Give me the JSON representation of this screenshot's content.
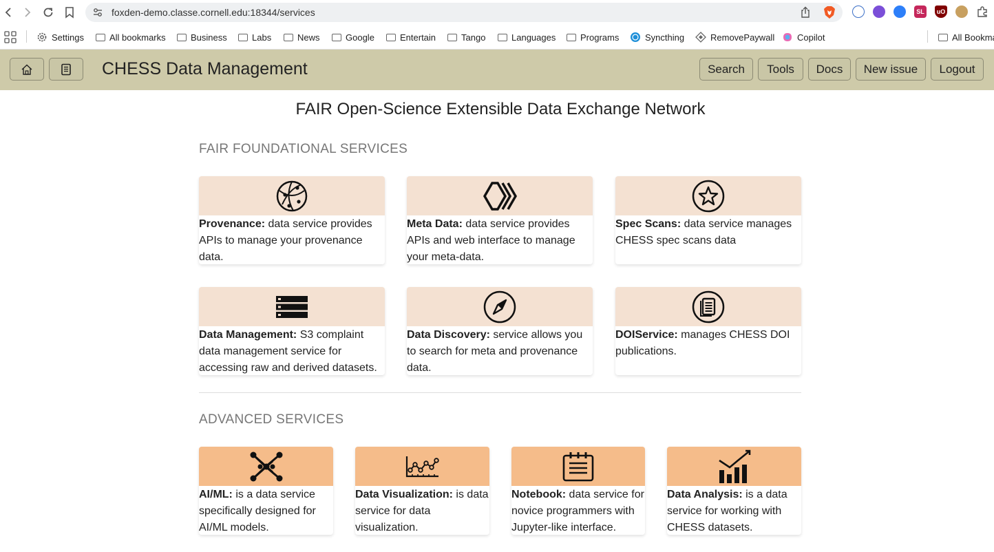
{
  "browser": {
    "url": "foxden-demo.classe.cornell.edu:18344/services",
    "bookmarks": [
      "Settings",
      "All bookmarks",
      "Business",
      "Labs",
      "News",
      "Google",
      "Entertain",
      "Tango",
      "Languages",
      "Programs",
      "Syncthing",
      "RemovePaywall",
      "Copilot"
    ],
    "all_bookmarks": "All Bookma",
    "extensions": [
      "SL",
      "uO"
    ]
  },
  "header": {
    "title": "CHESS Data Management",
    "buttons": [
      "Search",
      "Tools",
      "Docs",
      "New issue",
      "Logout"
    ]
  },
  "page_title": "FAIR Open-Science Extensible Data Exchange Network",
  "sections": {
    "foundational": {
      "title": "FAIR FOUNDATIONAL SERVICES",
      "cards": [
        {
          "name": "Provenance:",
          "desc": " data service provides APIs to manage your provenance data.",
          "icon": "globe-icon"
        },
        {
          "name": "Meta Data:",
          "desc": " data service provides APIs and web interface to manage your meta-data.",
          "icon": "chevrons-icon"
        },
        {
          "name": "Spec Scans:",
          "desc": " data service manages CHESS spec scans data",
          "icon": "star-circle-icon"
        },
        {
          "name": "Data Management:",
          "desc": " S3 complaint data management service for accessing raw and derived datasets.",
          "icon": "server-icon"
        },
        {
          "name": "Data Discovery:",
          "desc": " service allows you to search for meta and provenance data.",
          "icon": "compass-icon"
        },
        {
          "name": "DOIService:",
          "desc": " manages CHESS DOI publications.",
          "icon": "document-circle-icon"
        }
      ]
    },
    "advanced": {
      "title": "ADVANCED SERVICES",
      "cards": [
        {
          "name": "AI/ML:",
          "desc": " is a data service specifically designed for AI/ML models.",
          "icon": "network-icon"
        },
        {
          "name": "Data Visualization:",
          "desc": " is data service for data visualization.",
          "icon": "line-chart-icon"
        },
        {
          "name": "Notebook:",
          "desc": " data service for novice programmers with Jupyter-like interface.",
          "icon": "notebook-icon"
        },
        {
          "name": "Data Analysis:",
          "desc": " is a data service for working with CHESS datasets.",
          "icon": "bar-chart-icon"
        }
      ]
    }
  },
  "colors": {
    "header_bg": "#cecaa9",
    "foundational_card_head": "#f4e1d2",
    "advanced_card_head": "#f5bc8a"
  }
}
